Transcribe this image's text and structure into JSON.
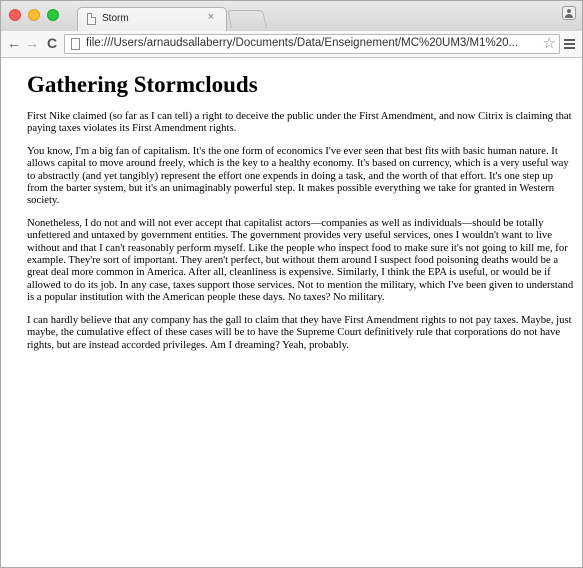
{
  "browser": {
    "tab_title": "Storm",
    "tab_close_glyph": "×",
    "url": "file:///Users/arnaudsallaberry/Documents/Data/Enseignement/MC%20UM3/M1%20...",
    "icons": {
      "back": "back-arrow-icon",
      "forward": "forward-arrow-icon",
      "reload": "reload-icon",
      "page": "page-icon",
      "bookmark": "star-icon",
      "menu": "hamburger-menu-icon",
      "profile": "profile-icon"
    },
    "traffic_light_colors": [
      "#fc5f57",
      "#fdbb2e",
      "#28c840"
    ]
  },
  "page": {
    "heading": "Gathering Stormclouds",
    "paragraphs": [
      "First Nike claimed (so far as I can tell) a right to deceive the public under the First Amendment, and now Citrix is claiming that paying taxes violates its First Amendment rights.",
      "You know, I'm a big fan of capitalism. It's the one form of economics I've ever seen that best fits with basic human nature. It allows capital to move around freely, which is the key to a healthy economy. It's based on currency, which is a very useful way to abstractly (and yet tangibly) represent the effort one expends in doing a task, and the worth of that effort. It's one step up from the barter system, but it's an unimaginably powerful step. It makes possible everything we take for granted in Western society.",
      "Nonetheless, I do not and will not ever accept that capitalist actors—companies as well as individuals—should be totally unfettered and untaxed by government entities. The government provides very useful services, ones I wouldn't want to live without and that I can't reasonably perform myself. Like the people who inspect food to make sure it's not going to kill me, for example. They're sort of important. They aren't perfect, but without them around I suspect food poisoning deaths would be a great deal more common in America. After all, cleanliness is expensive. Similarly, I think the EPA is useful, or would be if allowed to do its job. In any case, taxes support those services. Not to mention the military, which I've been given to understand is a popular institution with the American people these days. No taxes? No military.",
      "I can hardly believe that any company has the gall to claim that they have First Amendment rights to not pay taxes. Maybe, just maybe, the cumulative effect of these cases will be to have the Supreme Court definitively rule that corporations do not have rights, but are instead accorded privileges. Am I dreaming? Yeah, probably."
    ]
  }
}
